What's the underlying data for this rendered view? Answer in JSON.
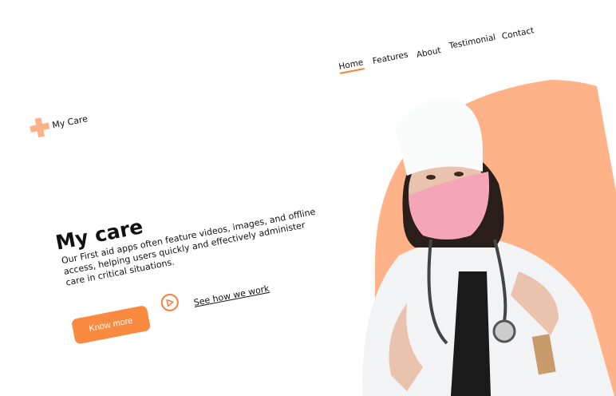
{
  "brand": {
    "name": "My Care",
    "icon": "cross-icon",
    "color": "#ffb287"
  },
  "nav": {
    "items": [
      {
        "label": "Home",
        "active": true
      },
      {
        "label": "Features"
      },
      {
        "label": "About"
      },
      {
        "label": "Testimonial"
      },
      {
        "label": "Contact"
      }
    ]
  },
  "hero": {
    "title": "My care",
    "description": "Our First aid apps often feature videos, images, and offline access, helping users quickly and effectively administer care in critical situations.",
    "primary_button": "Know more",
    "secondary_link": "See how we work",
    "play_icon": "play-circle-icon"
  },
  "colors": {
    "accent": "#f98a3f",
    "blob": "#ffb287",
    "mask": "#f4a5b8"
  }
}
